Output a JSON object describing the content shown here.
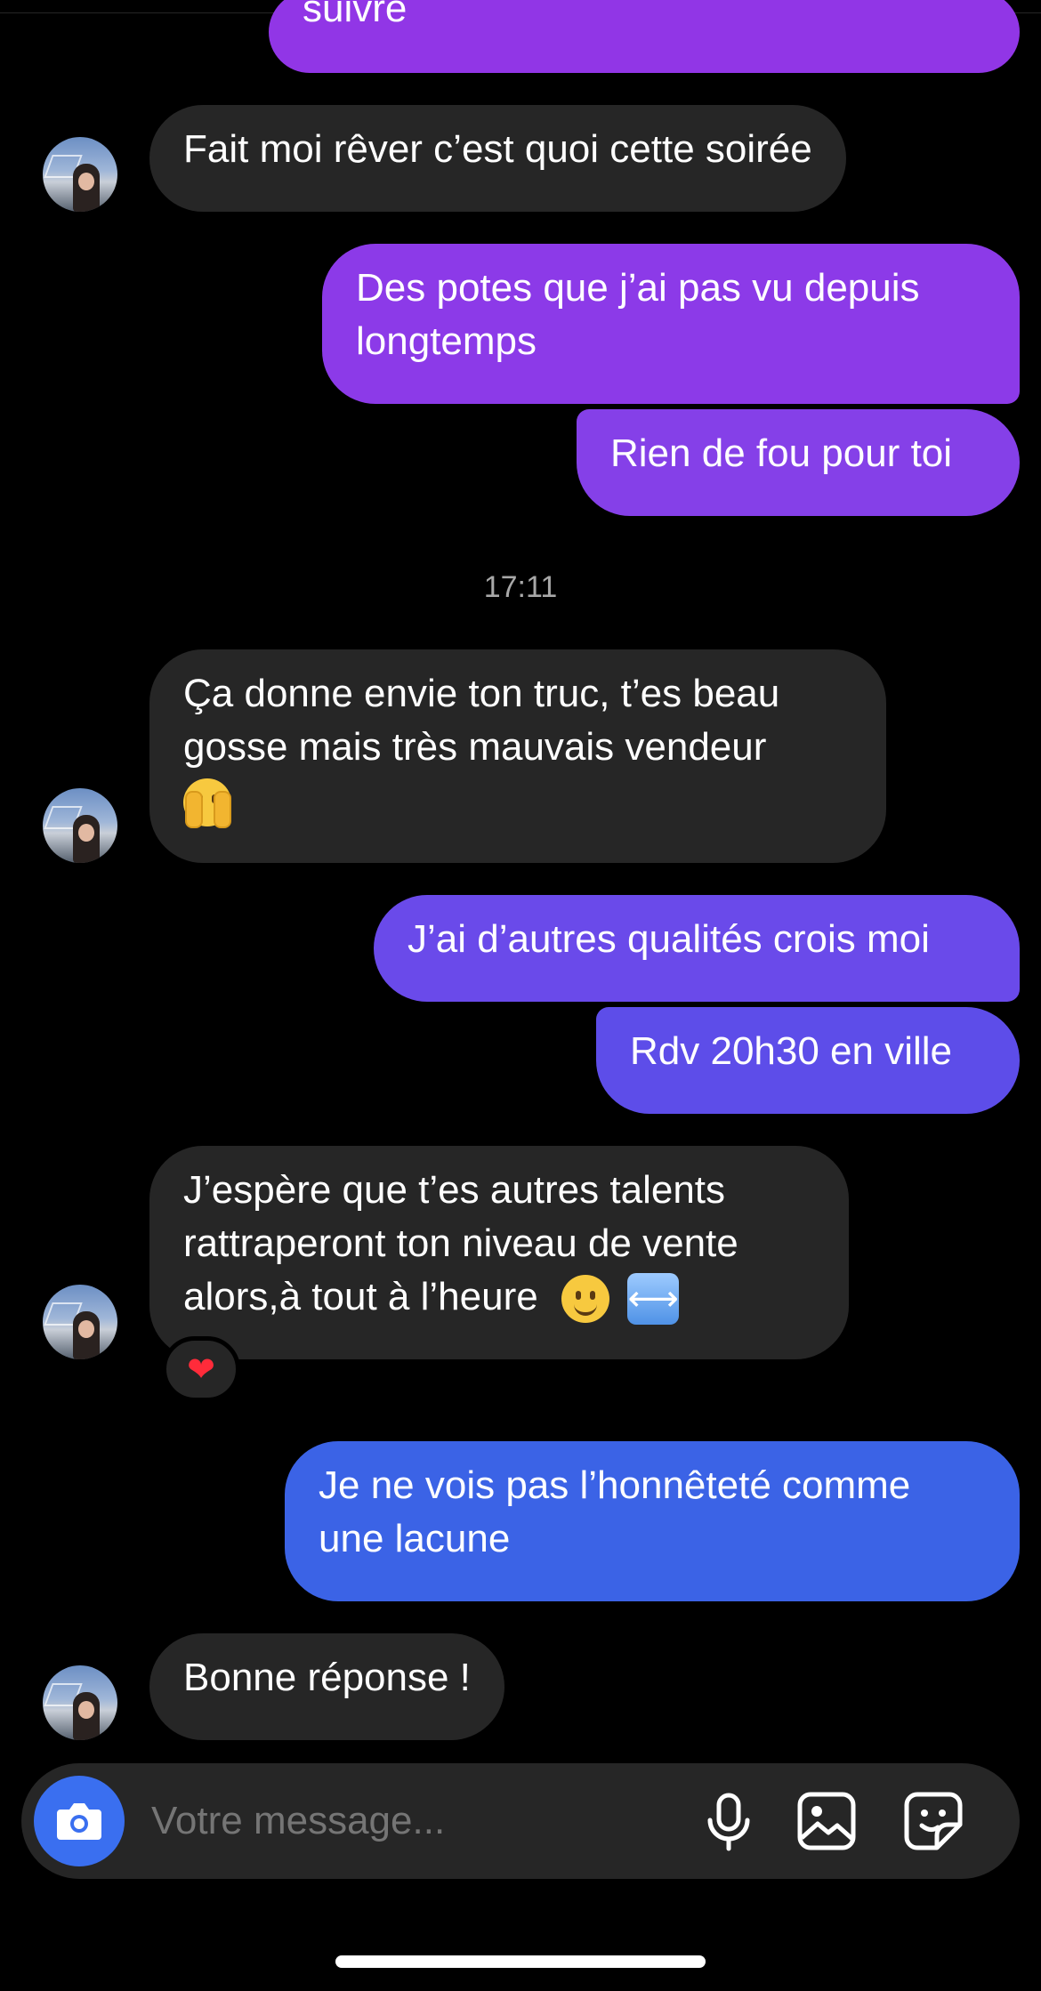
{
  "colors": {
    "background": "#000000",
    "received_bubble": "#262626",
    "sent_gradient_purple": "#9333ea",
    "sent_gradient_blue": "#3a63e6",
    "camera_button": "#3a6ff0",
    "timestamp_text": "#a8a8a8"
  },
  "messages": {
    "m0": "suivre",
    "m1": "Fait moi rêver c’est quoi cette soirée",
    "m2_line1": "Des potes que j’ai pas vu depuis",
    "m2_line2": "longtemps",
    "m3": "Rien de fou pour toi",
    "m4_line1": "Ça donne envie ton truc, t’es beau",
    "m4_line2": "gosse mais très mauvais vendeur",
    "m4_emoji": "face-with-open-eyes-and-hand-over-mouth",
    "m5": "J’ai d’autres qualités crois moi",
    "m6": "Rdv 20h30 en ville",
    "m7_line1": "J’espère que t’es autres talents",
    "m7_line2": "rattraperont ton niveau de vente",
    "m7_line3": "alors,à tout à l’heure",
    "m7_emoji1": "slightly-smiling-face",
    "m7_emoji2": "left-right-arrow",
    "m7_reaction": "heart",
    "m8_line1": "Je ne vois pas l’honnêteté comme",
    "m8_line2": "une lacune",
    "m9": "Bonne réponse !"
  },
  "timestamp": "17:11",
  "composer": {
    "placeholder": "Votre message...",
    "icons": [
      "camera-icon",
      "microphone-icon",
      "gallery-icon",
      "sticker-icon"
    ]
  }
}
